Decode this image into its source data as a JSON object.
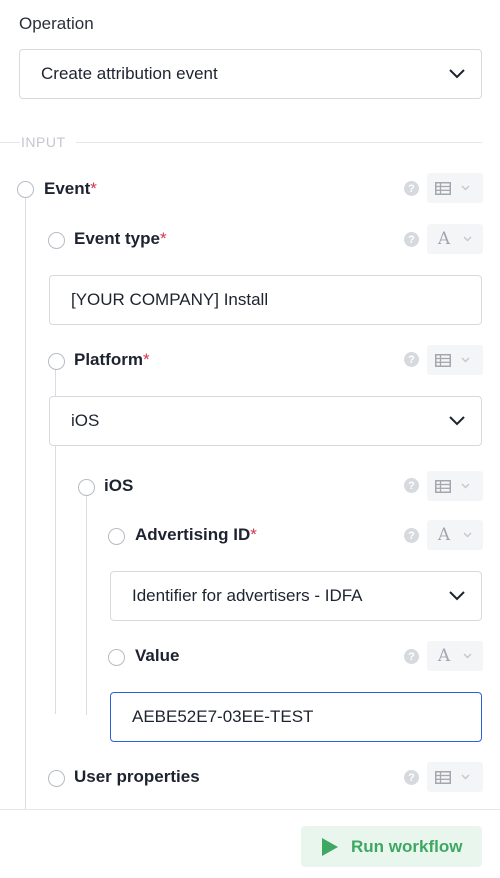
{
  "operation": {
    "label": "Operation",
    "selected": "Create attribution event"
  },
  "input_section": {
    "title": "INPUT"
  },
  "fields": {
    "event": {
      "label": "Event",
      "required": "*"
    },
    "event_type": {
      "label": "Event type",
      "required": "*",
      "value": "[YOUR COMPANY] Install"
    },
    "platform": {
      "label": "Platform",
      "required": "*",
      "selected": "iOS"
    },
    "ios": {
      "label": "iOS"
    },
    "advertising_id": {
      "label": "Advertising ID",
      "required": "*",
      "selected": "Identifier for advertisers - IDFA"
    },
    "value": {
      "label": "Value",
      "value": "AEBE52E7-03EE-TEST"
    },
    "user_properties": {
      "label": "User properties"
    }
  },
  "icons": {
    "help": "?",
    "text_type": "A"
  },
  "footer": {
    "run_label": "Run workflow"
  },
  "colors": {
    "required": "#d6334c",
    "focus_border": "#2c64d6",
    "run_text": "#3ea862",
    "run_bg": "#e9f6ee"
  }
}
